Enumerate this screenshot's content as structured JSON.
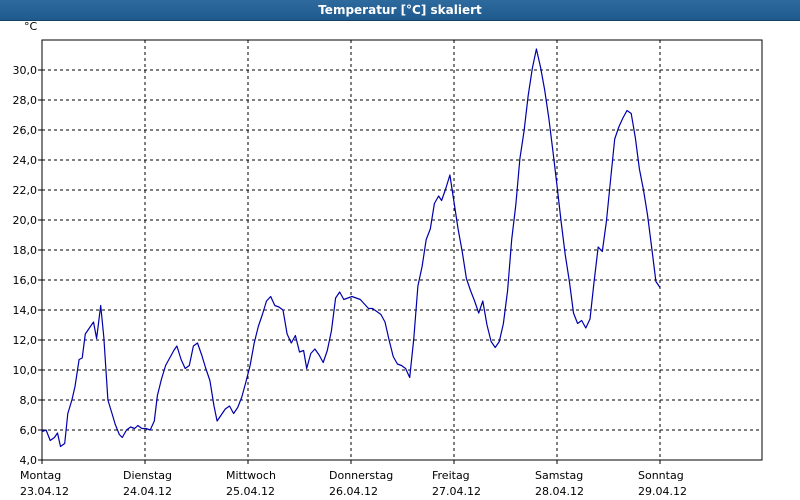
{
  "window": {
    "title": "Temperatur [°C] skaliert"
  },
  "chart_data": {
    "type": "line",
    "title": "Temperatur [°C] skaliert",
    "ylabel": "°C",
    "xlabel": "",
    "ylim": [
      4.0,
      32.0
    ],
    "ytick_values": [
      4.0,
      6.0,
      8.0,
      10.0,
      12.0,
      14.0,
      16.0,
      18.0,
      20.0,
      22.0,
      24.0,
      26.0,
      28.0,
      30.0
    ],
    "ytick_labels": [
      "4,0",
      "6,0",
      "8,0",
      "10,0",
      "12,0",
      "14,0",
      "16,0",
      "18,0",
      "20,0",
      "22,0",
      "24,0",
      "26,0",
      "28,0",
      "30,0"
    ],
    "xlim": [
      0,
      7
    ],
    "x_unit": "days since first label",
    "days": [
      {
        "name": "Montag",
        "date": "23.04.12"
      },
      {
        "name": "Dienstag",
        "date": "24.04.12"
      },
      {
        "name": "Mittwoch",
        "date": "25.04.12"
      },
      {
        "name": "Donnerstag",
        "date": "26.04.12"
      },
      {
        "name": "Freitag",
        "date": "27.04.12"
      },
      {
        "name": "Samstag",
        "date": "28.04.12"
      },
      {
        "name": "Sonntag",
        "date": "29.04.12"
      }
    ],
    "grid": true,
    "line_color": "#0000aa",
    "series": [
      {
        "points": [
          [
            0.0,
            5.9
          ],
          [
            0.04,
            6.0
          ],
          [
            0.08,
            5.3
          ],
          [
            0.12,
            5.5
          ],
          [
            0.15,
            5.8
          ],
          [
            0.18,
            4.9
          ],
          [
            0.22,
            5.1
          ],
          [
            0.25,
            7.1
          ],
          [
            0.29,
            8.0
          ],
          [
            0.32,
            8.9
          ],
          [
            0.36,
            10.7
          ],
          [
            0.39,
            10.8
          ],
          [
            0.42,
            12.4
          ],
          [
            0.46,
            12.8
          ],
          [
            0.5,
            13.2
          ],
          [
            0.53,
            12.1
          ],
          [
            0.57,
            14.3
          ],
          [
            0.6,
            12.2
          ],
          [
            0.64,
            8.0
          ],
          [
            0.68,
            7.1
          ],
          [
            0.71,
            6.4
          ],
          [
            0.75,
            5.7
          ],
          [
            0.78,
            5.5
          ],
          [
            0.82,
            6.0
          ],
          [
            0.86,
            6.2
          ],
          [
            0.9,
            6.1
          ],
          [
            0.93,
            6.3
          ],
          [
            0.97,
            6.1
          ],
          [
            1.01,
            6.1
          ],
          [
            1.05,
            6.0
          ],
          [
            1.09,
            6.6
          ],
          [
            1.12,
            8.3
          ],
          [
            1.16,
            9.4
          ],
          [
            1.2,
            10.3
          ],
          [
            1.24,
            10.8
          ],
          [
            1.28,
            11.3
          ],
          [
            1.31,
            11.6
          ],
          [
            1.35,
            10.7
          ],
          [
            1.39,
            10.1
          ],
          [
            1.43,
            10.3
          ],
          [
            1.47,
            11.6
          ],
          [
            1.51,
            11.8
          ],
          [
            1.55,
            11.0
          ],
          [
            1.59,
            10.1
          ],
          [
            1.63,
            9.3
          ],
          [
            1.67,
            7.6
          ],
          [
            1.7,
            6.6
          ],
          [
            1.74,
            7.0
          ],
          [
            1.78,
            7.4
          ],
          [
            1.82,
            7.6
          ],
          [
            1.86,
            7.1
          ],
          [
            1.9,
            7.5
          ],
          [
            1.94,
            8.2
          ],
          [
            1.98,
            9.2
          ],
          [
            2.02,
            10.3
          ],
          [
            2.06,
            11.8
          ],
          [
            2.1,
            12.9
          ],
          [
            2.14,
            13.7
          ],
          [
            2.18,
            14.6
          ],
          [
            2.22,
            14.9
          ],
          [
            2.26,
            14.3
          ],
          [
            2.3,
            14.2
          ],
          [
            2.34,
            14.0
          ],
          [
            2.38,
            12.4
          ],
          [
            2.42,
            11.8
          ],
          [
            2.46,
            12.3
          ],
          [
            2.5,
            11.2
          ],
          [
            2.54,
            11.3
          ],
          [
            2.57,
            10.1
          ],
          [
            2.61,
            11.1
          ],
          [
            2.65,
            11.4
          ],
          [
            2.69,
            11.0
          ],
          [
            2.73,
            10.5
          ],
          [
            2.77,
            11.3
          ],
          [
            2.81,
            12.6
          ],
          [
            2.85,
            14.8
          ],
          [
            2.89,
            15.2
          ],
          [
            2.93,
            14.7
          ],
          [
            2.97,
            14.8
          ],
          [
            3.01,
            14.9
          ],
          [
            3.05,
            14.8
          ],
          [
            3.09,
            14.7
          ],
          [
            3.13,
            14.4
          ],
          [
            3.17,
            14.1
          ],
          [
            3.21,
            14.1
          ],
          [
            3.25,
            13.9
          ],
          [
            3.29,
            13.7
          ],
          [
            3.33,
            13.2
          ],
          [
            3.37,
            12.0
          ],
          [
            3.41,
            10.9
          ],
          [
            3.45,
            10.4
          ],
          [
            3.49,
            10.3
          ],
          [
            3.53,
            10.1
          ],
          [
            3.57,
            9.5
          ],
          [
            3.61,
            12.1
          ],
          [
            3.65,
            15.6
          ],
          [
            3.69,
            16.9
          ],
          [
            3.73,
            18.7
          ],
          [
            3.77,
            19.4
          ],
          [
            3.81,
            21.1
          ],
          [
            3.85,
            21.6
          ],
          [
            3.88,
            21.3
          ],
          [
            3.92,
            22.1
          ],
          [
            3.96,
            23.0
          ],
          [
            4.0,
            21.2
          ],
          [
            4.04,
            19.4
          ],
          [
            4.08,
            17.9
          ],
          [
            4.12,
            16.1
          ],
          [
            4.16,
            15.3
          ],
          [
            4.2,
            14.6
          ],
          [
            4.24,
            13.8
          ],
          [
            4.28,
            14.6
          ],
          [
            4.32,
            13.0
          ],
          [
            4.36,
            11.9
          ],
          [
            4.4,
            11.5
          ],
          [
            4.44,
            11.9
          ],
          [
            4.48,
            13.1
          ],
          [
            4.52,
            15.3
          ],
          [
            4.56,
            18.7
          ],
          [
            4.6,
            21.0
          ],
          [
            4.64,
            24.1
          ],
          [
            4.68,
            25.9
          ],
          [
            4.72,
            28.3
          ],
          [
            4.76,
            30.1
          ],
          [
            4.8,
            31.4
          ],
          [
            4.84,
            30.2
          ],
          [
            4.88,
            28.7
          ],
          [
            4.92,
            26.8
          ],
          [
            4.96,
            24.6
          ],
          [
            5.0,
            22.3
          ],
          [
            5.04,
            19.9
          ],
          [
            5.08,
            17.7
          ],
          [
            5.12,
            15.9
          ],
          [
            5.16,
            13.8
          ],
          [
            5.2,
            13.1
          ],
          [
            5.24,
            13.3
          ],
          [
            5.28,
            12.8
          ],
          [
            5.32,
            13.4
          ],
          [
            5.36,
            15.9
          ],
          [
            5.4,
            18.2
          ],
          [
            5.44,
            17.9
          ],
          [
            5.48,
            19.9
          ],
          [
            5.52,
            22.7
          ],
          [
            5.56,
            25.4
          ],
          [
            5.6,
            26.2
          ],
          [
            5.64,
            26.8
          ],
          [
            5.68,
            27.3
          ],
          [
            5.72,
            27.1
          ],
          [
            5.76,
            25.5
          ],
          [
            5.8,
            23.4
          ],
          [
            5.84,
            22.0
          ],
          [
            5.88,
            20.3
          ],
          [
            5.92,
            18.1
          ],
          [
            5.96,
            15.9
          ],
          [
            6.0,
            15.5
          ]
        ]
      }
    ]
  }
}
